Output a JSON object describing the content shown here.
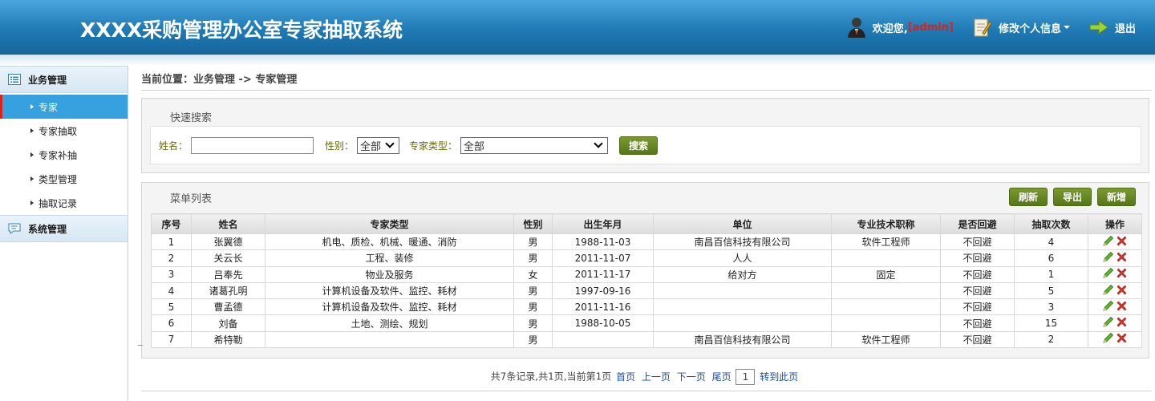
{
  "app": {
    "title": "XXXX采购管理办公室专家抽取系统"
  },
  "header": {
    "welcome": "欢迎您,",
    "user": "[admin]",
    "profile": "修改个人信息",
    "logout": "退出",
    "colors": {
      "accent": "#1f7ab5",
      "user": "#d9231c"
    }
  },
  "sidebar": {
    "groups": [
      {
        "label": "业务管理",
        "icon": "list-icon",
        "items": [
          {
            "label": "专家",
            "active": true
          },
          {
            "label": "专家抽取"
          },
          {
            "label": "专家补抽"
          },
          {
            "label": "类型管理"
          },
          {
            "label": "抽取记录"
          }
        ]
      },
      {
        "label": "系统管理",
        "icon": "message-icon",
        "items": []
      }
    ]
  },
  "breadcrumb": "当前位置：业务管理 -> 专家管理",
  "search": {
    "title": "快速搜索",
    "name_label": "姓名：",
    "name_value": "",
    "gender_label": "性别：",
    "gender_value": "全部",
    "type_label": "专家类型：",
    "type_value": "全部",
    "button": "搜索"
  },
  "list": {
    "title": "菜单列表",
    "buttons": {
      "refresh": "刷新",
      "export": "导出",
      "add": "新增"
    },
    "columns": [
      "序号",
      "姓名",
      "专家类型",
      "性别",
      "出生年月",
      "单位",
      "专业技术职称",
      "是否回避",
      "抽取次数",
      "操作"
    ],
    "rows": [
      [
        "1",
        "张翼德",
        "机电、质检、机械、暖通、消防",
        "男",
        "1988-11-03",
        "南昌百信科技有限公司",
        "软件工程师",
        "不回避",
        "4"
      ],
      [
        "2",
        "关云长",
        "工程、装修",
        "男",
        "2011-11-07",
        "人人",
        "",
        "不回避",
        "6"
      ],
      [
        "3",
        "吕奉先",
        "物业及服务",
        "女",
        "2011-11-17",
        "给对方",
        "固定",
        "不回避",
        "1"
      ],
      [
        "4",
        "诸葛孔明",
        "计算机设备及软件、监控、耗材",
        "男",
        "1997-09-16",
        "",
        "",
        "不回避",
        "5"
      ],
      [
        "5",
        "曹孟德",
        "计算机设备及软件、监控、耗材",
        "男",
        "2011-11-16",
        "",
        "",
        "不回避",
        "3"
      ],
      [
        "6",
        "刘备",
        "土地、测绘、规划",
        "男",
        "1988-10-05",
        "",
        "",
        "不回避",
        "15"
      ],
      [
        "7",
        "希特勒",
        "",
        "男",
        "",
        "南昌百信科技有限公司",
        "软件工程师",
        "不回避",
        "2"
      ]
    ]
  },
  "pager": {
    "summary": "共7条记录,共1页,当前第1页",
    "first": "首页",
    "prev": "上一页",
    "next": "下一页",
    "last": "尾页",
    "page_value": "1",
    "goto": "转到此页"
  }
}
